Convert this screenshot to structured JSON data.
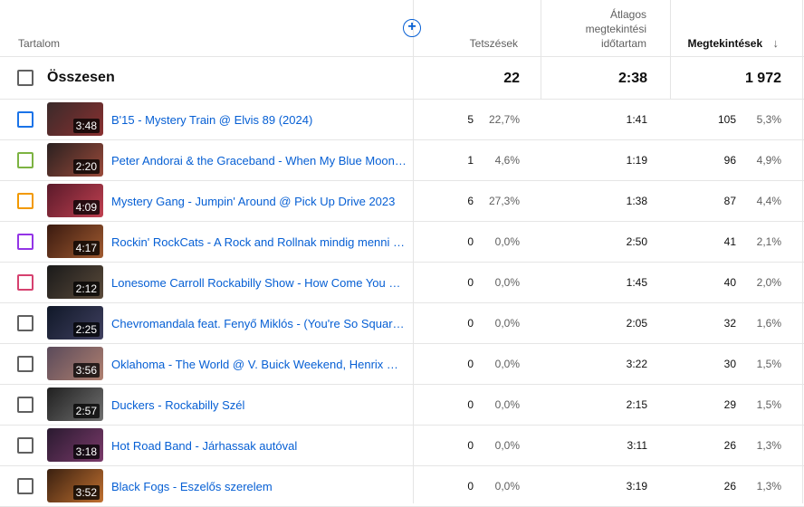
{
  "header": {
    "content_label": "Tartalom",
    "add_icon": "plus-circle-icon",
    "likes_label": "Tetszések",
    "avg_label_1": "Átlagos",
    "avg_label_2": "megtekintési",
    "avg_label_3": "időtartam",
    "views_label": "Megtekintések",
    "sort_icon": "arrow-down-icon",
    "sort_glyph": "↓"
  },
  "total": {
    "label": "Összesen",
    "likes": "22",
    "avg_duration": "2:38",
    "views": "1 972"
  },
  "rows": [
    {
      "checkbox_color": "#1a73e8",
      "duration": "3:48",
      "title": "B'15 - Mystery Train @ Elvis 89 (2024)",
      "likes": "5",
      "likes_pct": "22,7%",
      "avg": "1:41",
      "views": "105",
      "views_pct": "5,3%",
      "thumb_colors": [
        "#3a2a2a",
        "#8a3030"
      ]
    },
    {
      "checkbox_color": "#7cb342",
      "duration": "2:20",
      "title": "Peter Andorai & the Graceband - When My Blue Moon Turns to Gold Again",
      "likes": "1",
      "likes_pct": "4,6%",
      "avg": "1:19",
      "views": "96",
      "views_pct": "4,9%",
      "thumb_colors": [
        "#2a2020",
        "#9a4a3a"
      ]
    },
    {
      "checkbox_color": "#f29900",
      "duration": "4:09",
      "title": "Mystery Gang - Jumpin' Around @ Pick Up Drive 2023",
      "likes": "6",
      "likes_pct": "27,3%",
      "avg": "1:38",
      "views": "87",
      "views_pct": "4,4%",
      "thumb_colors": [
        "#5a1a2a",
        "#c04050"
      ]
    },
    {
      "checkbox_color": "#9334e6",
      "duration": "4:17",
      "title": "Rockin' RockCats - A Rock and Rollnak mindig menni kell",
      "likes": "0",
      "likes_pct": "0,0%",
      "avg": "2:50",
      "views": "41",
      "views_pct": "2,1%",
      "thumb_colors": [
        "#3a1a10",
        "#a05a30"
      ]
    },
    {
      "checkbox_color": "#d6416f",
      "duration": "2:12",
      "title": "Lonesome Carroll Rockabilly Show - How Come You Do Me",
      "likes": "0",
      "likes_pct": "0,0%",
      "avg": "1:45",
      "views": "40",
      "views_pct": "2,0%",
      "thumb_colors": [
        "#1a1a1a",
        "#5a4a3a"
      ]
    },
    {
      "checkbox_color": "#606060",
      "duration": "2:25",
      "title": "Chevromandala feat. Fenyő Miklós - (You're So Square) Baby I Don't Care",
      "likes": "0",
      "likes_pct": "0,0%",
      "avg": "2:05",
      "views": "32",
      "views_pct": "1,6%",
      "thumb_colors": [
        "#101828",
        "#404060"
      ]
    },
    {
      "checkbox_color": "#606060",
      "duration": "3:56",
      "title": "Oklahoma - The World @ V. Buick Weekend, Henrix Weekend",
      "likes": "0",
      "likes_pct": "0,0%",
      "avg": "3:22",
      "views": "30",
      "views_pct": "1,5%",
      "thumb_colors": [
        "#5a4a5a",
        "#b08070"
      ]
    },
    {
      "checkbox_color": "#606060",
      "duration": "2:57",
      "title": "Duckers - Rockabilly Szél",
      "likes": "0",
      "likes_pct": "0,0%",
      "avg": "2:15",
      "views": "29",
      "views_pct": "1,5%",
      "thumb_colors": [
        "#202020",
        "#707070"
      ]
    },
    {
      "checkbox_color": "#606060",
      "duration": "3:18",
      "title": "Hot Road Band - Járhassak autóval",
      "likes": "0",
      "likes_pct": "0,0%",
      "avg": "3:11",
      "views": "26",
      "views_pct": "1,3%",
      "thumb_colors": [
        "#2a1a30",
        "#7a3a6a"
      ]
    },
    {
      "checkbox_color": "#606060",
      "duration": "3:52",
      "title": "Black Fogs - Eszelős szerelem",
      "likes": "0",
      "likes_pct": "0,0%",
      "avg": "3:19",
      "views": "26",
      "views_pct": "1,3%",
      "thumb_colors": [
        "#3a2010",
        "#c07030"
      ]
    }
  ]
}
